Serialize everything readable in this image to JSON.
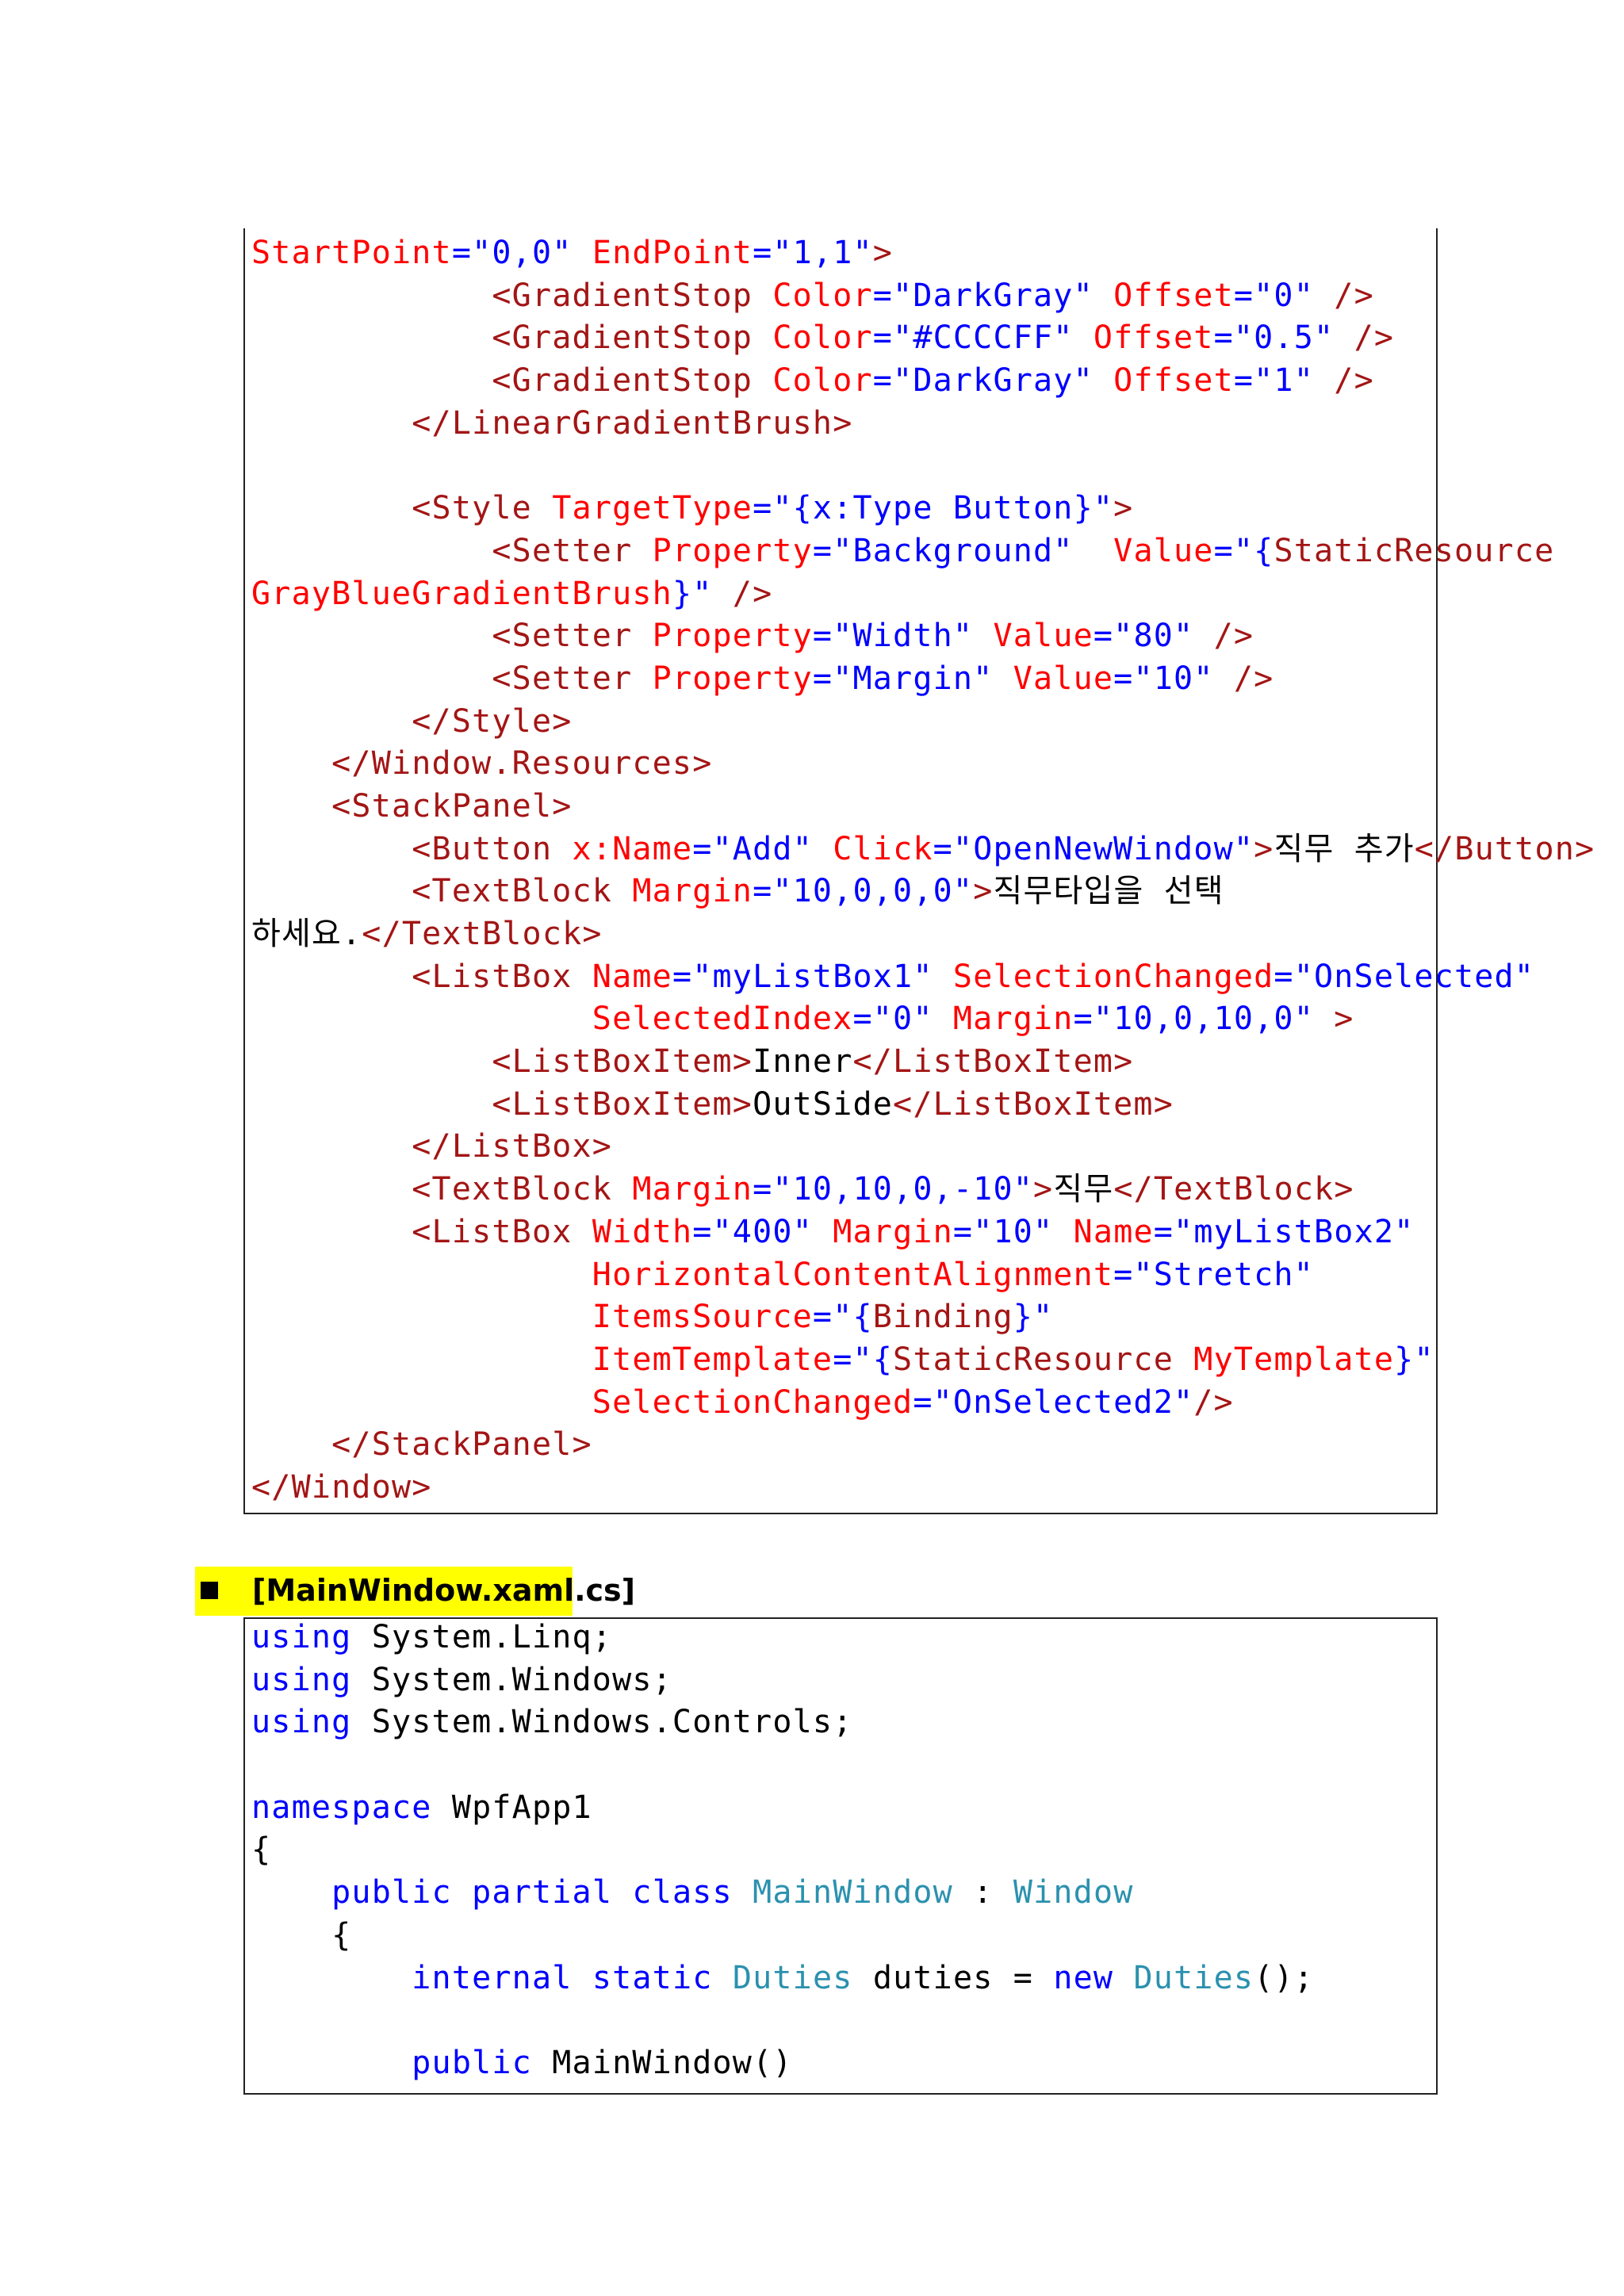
{
  "xaml_code": {
    "lines": [
      [
        {
          "t": "StartPoint",
          "c": "attr"
        },
        {
          "t": "=\"0,0\" ",
          "c": "val"
        },
        {
          "t": "EndPoint",
          "c": "attr"
        },
        {
          "t": "=\"1,1\"",
          "c": "val"
        },
        {
          "t": ">",
          "c": "tag"
        }
      ],
      [
        {
          "t": "            ",
          "c": "txt"
        },
        {
          "t": "<GradientStop ",
          "c": "tag"
        },
        {
          "t": "Color",
          "c": "attr"
        },
        {
          "t": "=\"DarkGray\" ",
          "c": "val"
        },
        {
          "t": "Offset",
          "c": "attr"
        },
        {
          "t": "=\"0\" ",
          "c": "val"
        },
        {
          "t": "/>",
          "c": "tag"
        }
      ],
      [
        {
          "t": "            ",
          "c": "txt"
        },
        {
          "t": "<GradientStop ",
          "c": "tag"
        },
        {
          "t": "Color",
          "c": "attr"
        },
        {
          "t": "=\"#CCCCFF\" ",
          "c": "val"
        },
        {
          "t": "Offset",
          "c": "attr"
        },
        {
          "t": "=\"0.5\" ",
          "c": "val"
        },
        {
          "t": "/>",
          "c": "tag"
        }
      ],
      [
        {
          "t": "            ",
          "c": "txt"
        },
        {
          "t": "<GradientStop ",
          "c": "tag"
        },
        {
          "t": "Color",
          "c": "attr"
        },
        {
          "t": "=\"DarkGray\" ",
          "c": "val"
        },
        {
          "t": "Offset",
          "c": "attr"
        },
        {
          "t": "=\"1\" ",
          "c": "val"
        },
        {
          "t": "/>",
          "c": "tag"
        }
      ],
      [
        {
          "t": "        ",
          "c": "txt"
        },
        {
          "t": "</LinearGradientBrush>",
          "c": "tag"
        }
      ],
      [
        {
          "t": "",
          "c": "txt"
        }
      ],
      [
        {
          "t": "        ",
          "c": "txt"
        },
        {
          "t": "<Style ",
          "c": "tag"
        },
        {
          "t": "TargetType",
          "c": "attr"
        },
        {
          "t": "=\"{x:Type Button}\"",
          "c": "val"
        },
        {
          "t": ">",
          "c": "tag"
        }
      ],
      [
        {
          "t": "            ",
          "c": "txt"
        },
        {
          "t": "<Setter ",
          "c": "tag"
        },
        {
          "t": "Property",
          "c": "attr"
        },
        {
          "t": "=\"Background\"  ",
          "c": "val"
        },
        {
          "t": "Value",
          "c": "attr"
        },
        {
          "t": "=\"{",
          "c": "val"
        },
        {
          "t": "StaticResource",
          "c": "tag"
        }
      ],
      [
        {
          "t": "GrayBlueGradientBrush",
          "c": "attr"
        },
        {
          "t": "}\" ",
          "c": "val"
        },
        {
          "t": "/>",
          "c": "tag"
        }
      ],
      [
        {
          "t": "            ",
          "c": "txt"
        },
        {
          "t": "<Setter ",
          "c": "tag"
        },
        {
          "t": "Property",
          "c": "attr"
        },
        {
          "t": "=\"Width\" ",
          "c": "val"
        },
        {
          "t": "Value",
          "c": "attr"
        },
        {
          "t": "=\"80\" ",
          "c": "val"
        },
        {
          "t": "/>",
          "c": "tag"
        }
      ],
      [
        {
          "t": "            ",
          "c": "txt"
        },
        {
          "t": "<Setter ",
          "c": "tag"
        },
        {
          "t": "Property",
          "c": "attr"
        },
        {
          "t": "=\"Margin\" ",
          "c": "val"
        },
        {
          "t": "Value",
          "c": "attr"
        },
        {
          "t": "=\"10\" ",
          "c": "val"
        },
        {
          "t": "/>",
          "c": "tag"
        }
      ],
      [
        {
          "t": "        ",
          "c": "txt"
        },
        {
          "t": "</Style>",
          "c": "tag"
        }
      ],
      [
        {
          "t": "    ",
          "c": "txt"
        },
        {
          "t": "</Window.Resources>",
          "c": "tag"
        }
      ],
      [
        {
          "t": "    ",
          "c": "txt"
        },
        {
          "t": "<StackPanel>",
          "c": "tag"
        }
      ],
      [
        {
          "t": "        ",
          "c": "txt"
        },
        {
          "t": "<Button ",
          "c": "tag"
        },
        {
          "t": "x:Name",
          "c": "attr"
        },
        {
          "t": "=\"Add\" ",
          "c": "val"
        },
        {
          "t": "Click",
          "c": "attr"
        },
        {
          "t": "=\"OpenNewWindow\"",
          "c": "val"
        },
        {
          "t": ">",
          "c": "tag"
        },
        {
          "t": "직무 추가",
          "c": "txt"
        },
        {
          "t": "</Button>",
          "c": "tag"
        }
      ],
      [
        {
          "t": "        ",
          "c": "txt"
        },
        {
          "t": "<TextBlock ",
          "c": "tag"
        },
        {
          "t": "Margin",
          "c": "attr"
        },
        {
          "t": "=\"10,0,0,0\"",
          "c": "val"
        },
        {
          "t": ">",
          "c": "tag"
        },
        {
          "t": "직무타입을 선택",
          "c": "txt"
        }
      ],
      [
        {
          "t": "하세요.",
          "c": "txt"
        },
        {
          "t": "</TextBlock>",
          "c": "tag"
        }
      ],
      [
        {
          "t": "        ",
          "c": "txt"
        },
        {
          "t": "<ListBox ",
          "c": "tag"
        },
        {
          "t": "Name",
          "c": "attr"
        },
        {
          "t": "=\"myListBox1\" ",
          "c": "val"
        },
        {
          "t": "SelectionChanged",
          "c": "attr"
        },
        {
          "t": "=\"OnSelected\"",
          "c": "val"
        }
      ],
      [
        {
          "t": "                 ",
          "c": "txt"
        },
        {
          "t": "SelectedIndex",
          "c": "attr"
        },
        {
          "t": "=\"0\" ",
          "c": "val"
        },
        {
          "t": "Margin",
          "c": "attr"
        },
        {
          "t": "=\"10,0,10,0\" ",
          "c": "val"
        },
        {
          "t": ">",
          "c": "tag"
        }
      ],
      [
        {
          "t": "            ",
          "c": "txt"
        },
        {
          "t": "<ListBoxItem>",
          "c": "tag"
        },
        {
          "t": "Inner",
          "c": "txt"
        },
        {
          "t": "</ListBoxItem>",
          "c": "tag"
        }
      ],
      [
        {
          "t": "            ",
          "c": "txt"
        },
        {
          "t": "<ListBoxItem>",
          "c": "tag"
        },
        {
          "t": "OutSide",
          "c": "txt"
        },
        {
          "t": "</ListBoxItem>",
          "c": "tag"
        }
      ],
      [
        {
          "t": "        ",
          "c": "txt"
        },
        {
          "t": "</ListBox>",
          "c": "tag"
        }
      ],
      [
        {
          "t": "        ",
          "c": "txt"
        },
        {
          "t": "<TextBlock ",
          "c": "tag"
        },
        {
          "t": "Margin",
          "c": "attr"
        },
        {
          "t": "=\"10,10,0,-10\"",
          "c": "val"
        },
        {
          "t": ">",
          "c": "tag"
        },
        {
          "t": "직무",
          "c": "txt"
        },
        {
          "t": "</TextBlock>",
          "c": "tag"
        }
      ],
      [
        {
          "t": "        ",
          "c": "txt"
        },
        {
          "t": "<ListBox ",
          "c": "tag"
        },
        {
          "t": "Width",
          "c": "attr"
        },
        {
          "t": "=\"400\" ",
          "c": "val"
        },
        {
          "t": "Margin",
          "c": "attr"
        },
        {
          "t": "=\"10\" ",
          "c": "val"
        },
        {
          "t": "Name",
          "c": "attr"
        },
        {
          "t": "=\"myListBox2\"",
          "c": "val"
        }
      ],
      [
        {
          "t": "                 ",
          "c": "txt"
        },
        {
          "t": "HorizontalContentAlignment",
          "c": "attr"
        },
        {
          "t": "=\"Stretch\"",
          "c": "val"
        }
      ],
      [
        {
          "t": "                 ",
          "c": "txt"
        },
        {
          "t": "ItemsSource",
          "c": "attr"
        },
        {
          "t": "=\"{",
          "c": "val"
        },
        {
          "t": "Binding",
          "c": "tag"
        },
        {
          "t": "}\"",
          "c": "val"
        }
      ],
      [
        {
          "t": "                 ",
          "c": "txt"
        },
        {
          "t": "ItemTemplate",
          "c": "attr"
        },
        {
          "t": "=\"{",
          "c": "val"
        },
        {
          "t": "StaticResource ",
          "c": "tag"
        },
        {
          "t": "MyTemplate",
          "c": "attr"
        },
        {
          "t": "}\"",
          "c": "val"
        }
      ],
      [
        {
          "t": "                 ",
          "c": "txt"
        },
        {
          "t": "SelectionChanged",
          "c": "attr"
        },
        {
          "t": "=\"OnSelected2\"",
          "c": "val"
        },
        {
          "t": "/>",
          "c": "tag"
        }
      ],
      [
        {
          "t": "    ",
          "c": "txt"
        },
        {
          "t": "</StackPanel>",
          "c": "tag"
        }
      ],
      [
        {
          "t": "</Window>",
          "c": "tag"
        }
      ]
    ]
  },
  "section_heading": {
    "label": "[MainWindow.xaml.cs]"
  },
  "cs_code": {
    "lines": [
      [
        {
          "t": "using",
          "c": "kw"
        },
        {
          "t": " System.Linq;",
          "c": "txt"
        }
      ],
      [
        {
          "t": "using",
          "c": "kw"
        },
        {
          "t": " System.Windows;",
          "c": "txt"
        }
      ],
      [
        {
          "t": "using",
          "c": "kw"
        },
        {
          "t": " System.Windows.Controls;",
          "c": "txt"
        }
      ],
      [
        {
          "t": "",
          "c": "txt"
        }
      ],
      [
        {
          "t": "namespace",
          "c": "kw"
        },
        {
          "t": " WpfApp1",
          "c": "txt"
        }
      ],
      [
        {
          "t": "{",
          "c": "txt"
        }
      ],
      [
        {
          "t": "    ",
          "c": "txt"
        },
        {
          "t": "public",
          "c": "kw"
        },
        {
          "t": " ",
          "c": "txt"
        },
        {
          "t": "partial",
          "c": "kw"
        },
        {
          "t": " ",
          "c": "txt"
        },
        {
          "t": "class",
          "c": "kw"
        },
        {
          "t": " ",
          "c": "txt"
        },
        {
          "t": "MainWindow",
          "c": "type"
        },
        {
          "t": " : ",
          "c": "txt"
        },
        {
          "t": "Window",
          "c": "type"
        }
      ],
      [
        {
          "t": "    {",
          "c": "txt"
        }
      ],
      [
        {
          "t": "        ",
          "c": "txt"
        },
        {
          "t": "internal",
          "c": "kw"
        },
        {
          "t": " ",
          "c": "txt"
        },
        {
          "t": "static",
          "c": "kw"
        },
        {
          "t": " ",
          "c": "txt"
        },
        {
          "t": "Duties",
          "c": "type"
        },
        {
          "t": " duties = ",
          "c": "txt"
        },
        {
          "t": "new",
          "c": "kw"
        },
        {
          "t": " ",
          "c": "txt"
        },
        {
          "t": "Duties",
          "c": "type"
        },
        {
          "t": "();",
          "c": "txt"
        }
      ],
      [
        {
          "t": "",
          "c": "txt"
        }
      ],
      [
        {
          "t": "        ",
          "c": "txt"
        },
        {
          "t": "public",
          "c": "kw"
        },
        {
          "t": " MainWindow()",
          "c": "txt"
        }
      ]
    ]
  }
}
